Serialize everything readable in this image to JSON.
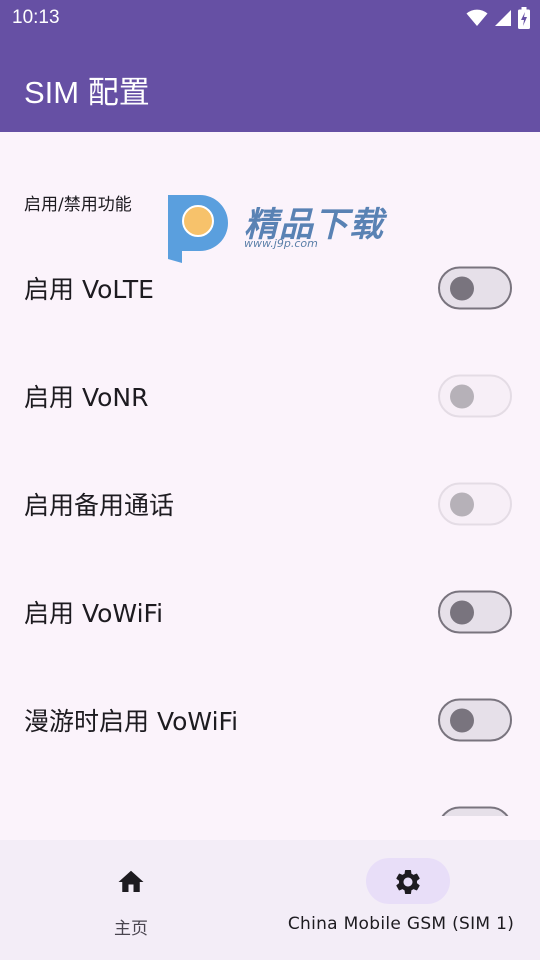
{
  "status_bar": {
    "time": "10:13",
    "icons": [
      "wifi-icon",
      "signal-icon",
      "battery-charging-icon"
    ]
  },
  "app_bar": {
    "title": "SIM 配置"
  },
  "section": {
    "header": "启用/禁用功能"
  },
  "watermark": {
    "brand": "精品下载",
    "url": "www.j9p.com"
  },
  "preferences": [
    {
      "label": "启用 VoLTE",
      "enabled": true,
      "checked": false
    },
    {
      "label": "启用 VoNR",
      "enabled": false,
      "checked": false
    },
    {
      "label": "启用备用通话",
      "enabled": false,
      "checked": false
    },
    {
      "label": "启用 VoWiFi",
      "enabled": true,
      "checked": false
    },
    {
      "label": "漫游时启用 VoWiFi",
      "enabled": true,
      "checked": false
    },
    {
      "label": "",
      "enabled": true,
      "checked": false
    }
  ],
  "bottom_nav": {
    "items": [
      {
        "label": "主页",
        "icon": "home-icon",
        "selected": false
      },
      {
        "label": "China Mobile GSM (SIM 1)",
        "icon": "gear-icon",
        "selected": true
      }
    ]
  },
  "colors": {
    "app_bar": "#6650a4",
    "background": "#fbf3fb",
    "nav_background": "#f3edf7",
    "nav_indicator": "#e8def8",
    "switch_outline": "#79747e",
    "switch_track": "#e6e0e9"
  }
}
